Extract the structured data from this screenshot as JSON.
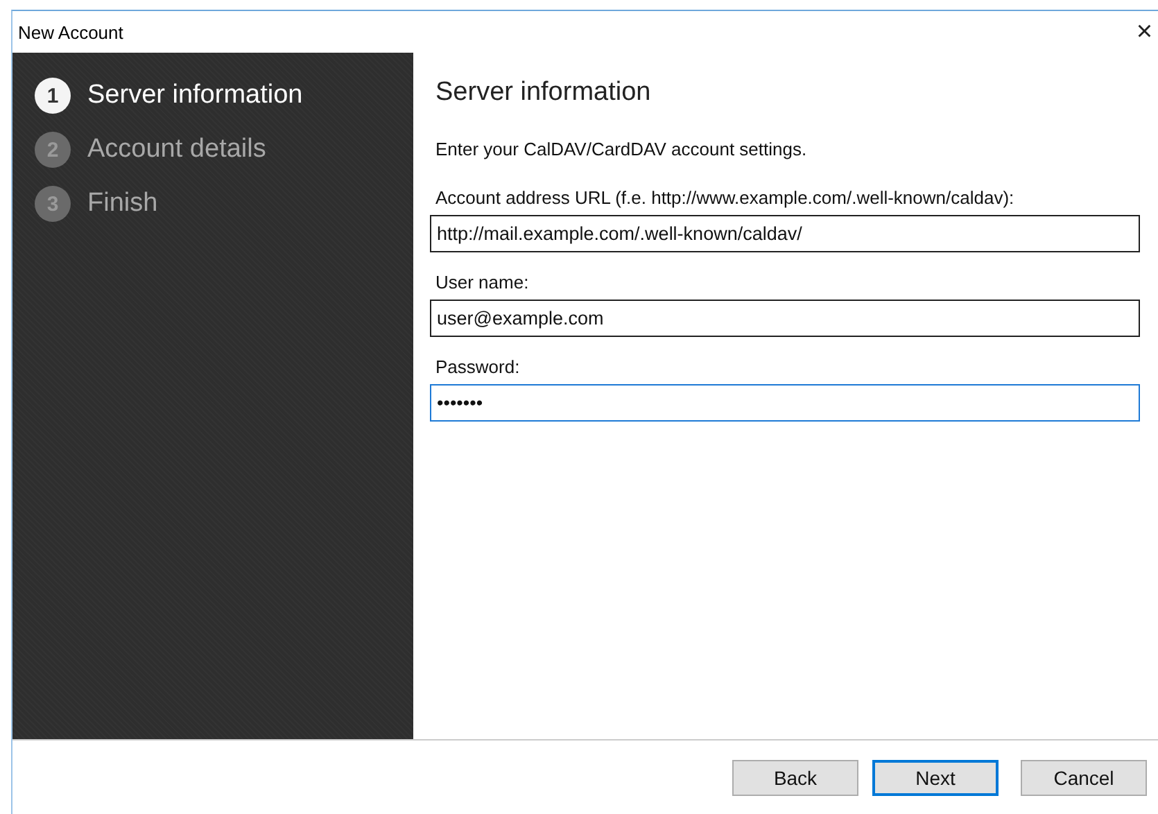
{
  "window": {
    "title": "New Account",
    "close": "×"
  },
  "steps": [
    {
      "number": "1",
      "label": "Server information",
      "selected": true
    },
    {
      "number": "2",
      "label": "Account details",
      "selected": false
    },
    {
      "number": "3",
      "label": "Finish",
      "selected": false
    }
  ],
  "page": {
    "heading": "Server information",
    "intro": "Enter your CalDAV/CardDAV account settings.",
    "fields": [
      {
        "label": "Account address URL (f.e. http://www.example.com/.well-known/caldav):",
        "value": "http://mail.example.com/.well-known/caldav/",
        "focused": false
      },
      {
        "label": "User name:",
        "value": "user@example.com",
        "focused": false
      },
      {
        "label": "Password:",
        "value": "•••••••",
        "focused": true
      }
    ]
  },
  "buttons": [
    {
      "label": "Back",
      "default": false
    },
    {
      "label": "Next",
      "default": true
    },
    {
      "label": "Cancel",
      "default": false
    }
  ]
}
